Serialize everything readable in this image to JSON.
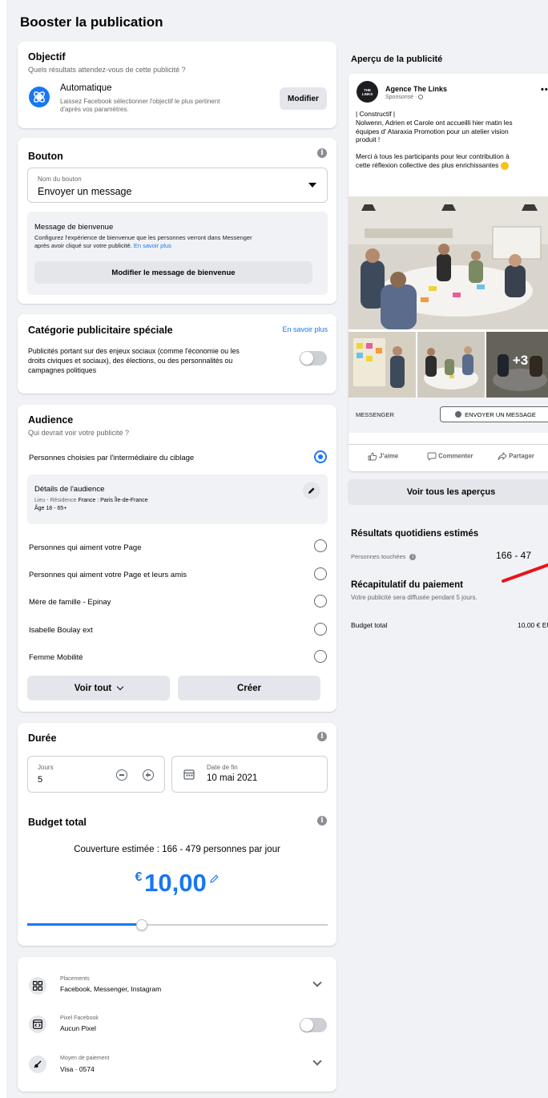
{
  "page_title": "Booster la publication",
  "objective": {
    "title": "Objectif",
    "subtitle": "Quels résultats attendez-vous de cette publicité ?",
    "option_title": "Automatique",
    "option_desc_line1": "Laissez Facebook sélectionner l'objectif le plus pertinent",
    "option_desc_line2": "d'après vos paramètres.",
    "modify_label": "Modifier"
  },
  "button_section": {
    "title": "Bouton",
    "select_label": "Nom du bouton",
    "select_value": "Envoyer un message",
    "welcome_title": "Message de bienvenue",
    "welcome_desc_line1": "Configurez l'expérience de bienvenue que les personnes verront dans Messenger",
    "welcome_desc_line2": "après avoir cliqué sur votre publicité.",
    "welcome_link": "En savoir plus",
    "welcome_button": "Modifier le message de bienvenue"
  },
  "special_category": {
    "title": "Catégorie publicitaire spéciale",
    "link": "En savoir plus",
    "desc_line1": "Publicités portant sur des enjeux sociaux (comme l'économie ou les",
    "desc_line2": "droits civiques et sociaux), des élections, ou des personnalités ou",
    "desc_line3": "campagnes politiques",
    "toggle_on": false
  },
  "audience": {
    "title": "Audience",
    "subtitle": "Qui devrait voir votre publicité ?",
    "targeted_label": "Personnes choisies par l'intermédiaire du ciblage",
    "details_title": "Détails de l'audience",
    "details_location_prefix": "Lieu - Résidence",
    "details_location_value": "France : Paris Île-de-France",
    "details_age": "Âge 18 - 65+",
    "items": [
      "Personnes qui aiment votre Page",
      "Personnes qui aiment votre Page et leurs amis",
      "Mère de famille - Epinay",
      "Isabelle Boulay ext",
      "Femme Mobilité"
    ],
    "see_all": "Voir tout",
    "create": "Créer"
  },
  "duration": {
    "title": "Durée",
    "days_label": "Jours",
    "days_value": "5",
    "end_label": "Date de fin",
    "end_value": "10 mai 2021"
  },
  "budget": {
    "title": "Budget total",
    "coverage": "Couverture estimée : 166 - 479 personnes par jour",
    "currency": "€",
    "amount": "10,00",
    "slider_fraction": 0.38
  },
  "settings": [
    {
      "label": "Placements",
      "value": "Facebook, Messenger, Instagram",
      "icon": "grid-icon",
      "control": "chevron"
    },
    {
      "label": "Pixel Facebook",
      "value": "Aucun Pixel",
      "icon": "pixel-code-icon",
      "control": "toggle"
    },
    {
      "label": "Moyen de paiement",
      "value": "Visa · 0574",
      "icon": "card-icon",
      "control": "chevron"
    }
  ],
  "preview": {
    "title": "Aperçu de la publicité",
    "page_name": "Agence The Links",
    "sponsored": "Sponsorisé ·",
    "avatar_text": "THE LINKS",
    "post_line1": "| Constructif |",
    "post_line2": "Nolwenn, Adrien et Carole ont accueilli hier matin les",
    "post_line3": "équipes d' Ataraxia Promotion pour un atelier vision",
    "post_line4": "produit !",
    "post_line5": "Merci à tous les participants pour leur contribution à",
    "post_line6": "cette réflexion collective des plus enrichissantes",
    "extra_photos": "+3",
    "cta_source": "MESSENGER",
    "cta_button": "ENVOYER UN MESSAGE",
    "like": "J'aime",
    "comment": "Commenter",
    "share": "Partager",
    "see_all_previews": "Voir tous les aperçus"
  },
  "results": {
    "title": "Résultats quotidiens estimés",
    "reached_label": "Personnes touchées",
    "reached_value": "166 - 47"
  },
  "payment": {
    "title": "Récapitulatif du paiement",
    "subtitle": "Votre publicité sera diffusée pendant 5 jours.",
    "total_label": "Budget total",
    "total_value": "10,00 € EU"
  },
  "colors": {
    "accent": "#1877f2",
    "annotation_arrow": "#e8141b"
  }
}
